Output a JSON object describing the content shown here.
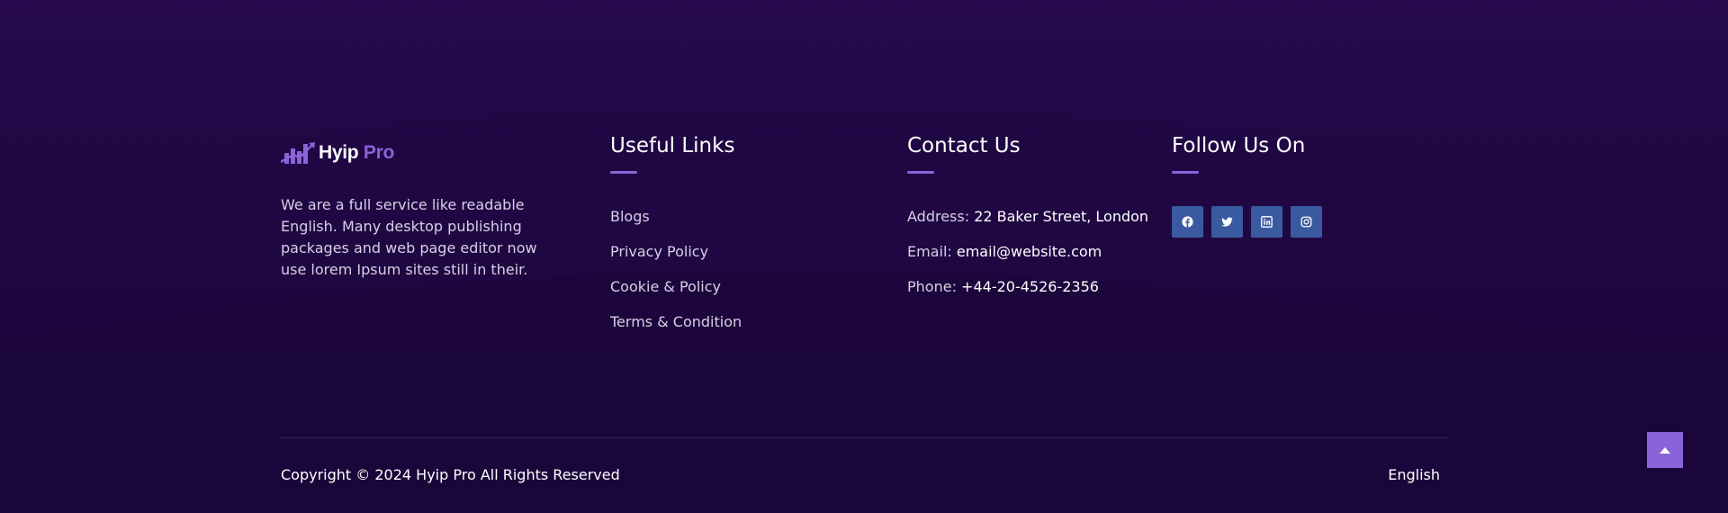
{
  "brand": {
    "name_main": "Hyip",
    "name_accent": "Pro",
    "logo_icon": "chart-bars-arrow-icon",
    "accent_color": "#8a63d8"
  },
  "about": {
    "text": "We are a full service like readable English. Many desktop publishing packages and web page editor now use lorem Ipsum sites still in their."
  },
  "useful_links": {
    "title": "Useful Links",
    "items": [
      "Blogs",
      "Privacy Policy",
      "Cookie & Policy",
      "Terms & Condition"
    ]
  },
  "contact": {
    "title": "Contact Us",
    "address_label": "Address:",
    "address_value": "22 Baker Street, London",
    "email_label": "Email:",
    "email_value": "email@website.com",
    "phone_label": "Phone:",
    "phone_value": "+44-20-4526-2356"
  },
  "follow": {
    "title": "Follow Us On",
    "icons": [
      "facebook-icon",
      "twitter-icon",
      "linkedin-icon",
      "instagram-icon"
    ],
    "button_color": "#3a5aa0"
  },
  "bottom": {
    "copyright": "Copyright © 2024 Hyip Pro All Rights Reserved",
    "language": "English"
  },
  "colors": {
    "background": "#1a0637",
    "scroll_top_button": "#8a63d8"
  }
}
